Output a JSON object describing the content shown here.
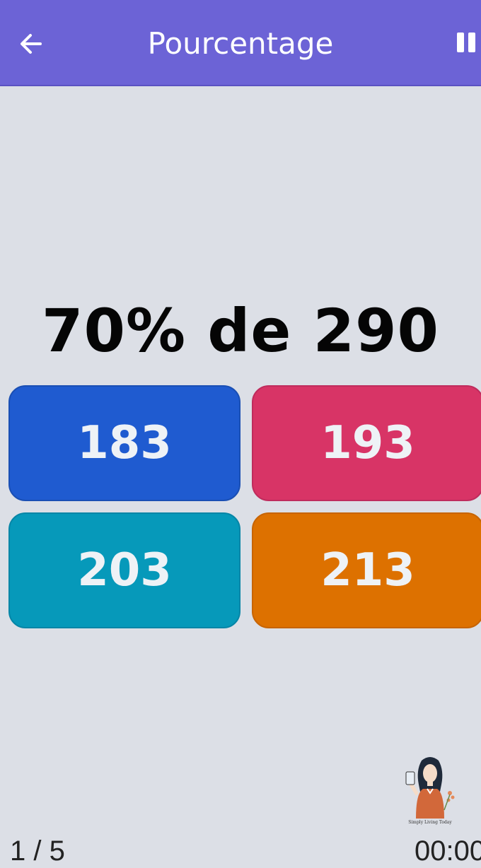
{
  "app_bar": {
    "title": "Pourcentage",
    "back_icon": "arrow-left-icon",
    "pause_icon": "pause-icon",
    "background_color": "#6c63d6"
  },
  "question": {
    "text": "70% de 290"
  },
  "answers": [
    {
      "label": "183",
      "color": "#1f5bd0"
    },
    {
      "label": "193",
      "color": "#d83466"
    },
    {
      "label": "203",
      "color": "#0699ba"
    },
    {
      "label": "213",
      "color": "#dd7100"
    }
  ],
  "footer": {
    "progress": "1 / 5",
    "timer": "00:00"
  },
  "watermark": {
    "caption": "Simply Living Today"
  }
}
